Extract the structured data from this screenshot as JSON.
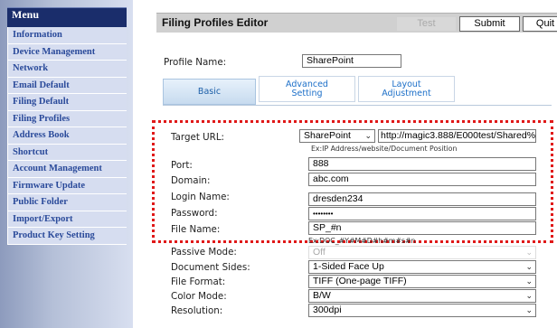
{
  "sidebar": {
    "menu_title": "Menu",
    "items": [
      "Information",
      "Device Management",
      "Network",
      "Email Default",
      "Filing Default",
      "Filing Profiles",
      "Address Book",
      "Shortcut",
      "Account Management",
      "Firmware Update",
      "Public Folder",
      "Import/Export",
      "Product Key Setting"
    ]
  },
  "header": {
    "title": "Filing Profiles Editor",
    "test_label": "Test",
    "submit_label": "Submit",
    "quit_label": "Quit"
  },
  "profile": {
    "name_label": "Profile Name:",
    "name_value": "SharePoint"
  },
  "tabs": {
    "basic": "Basic",
    "advanced_line1": "Advanced",
    "advanced_line2": "Setting",
    "layout_line1": "Layout",
    "layout_line2": "Adjustment"
  },
  "form": {
    "target_url_label": "Target URL:",
    "target_type": "SharePoint",
    "target_url_value": "http://magic3.888/E000test/Shared%",
    "target_hint": "Ex:IP Address/website/Document Position",
    "port_label": "Port:",
    "port_value": "888",
    "domain_label": "Domain:",
    "domain_value": "abc.com",
    "login_label": "Login Name:",
    "login_value": "dresden234",
    "password_label": "Password:",
    "password_value": "••••••••",
    "filename_label": "File Name:",
    "filename_value": "SP_#n",
    "filename_hint": "Ex:DOC_#Y#M#D#h#m#s#n",
    "passive_label": "Passive Mode:",
    "passive_value": "Off",
    "sides_label": "Document Sides:",
    "sides_value": "1-Sided Face Up",
    "format_label": "File Format:",
    "format_value": "TIFF (One-page TIFF)",
    "color_label": "Color Mode:",
    "color_value": "B/W",
    "resolution_label": "Resolution:",
    "resolution_value": "300dpi"
  },
  "colors": {
    "menu_header": "#1a2d6b",
    "menu_item_bg": "#d6ddf0",
    "menu_item_text": "#2a4a9a",
    "highlight_border": "#e01818",
    "tab_text": "#1c6fc8"
  },
  "icons": {
    "dropdown": "chevron-down-icon"
  }
}
